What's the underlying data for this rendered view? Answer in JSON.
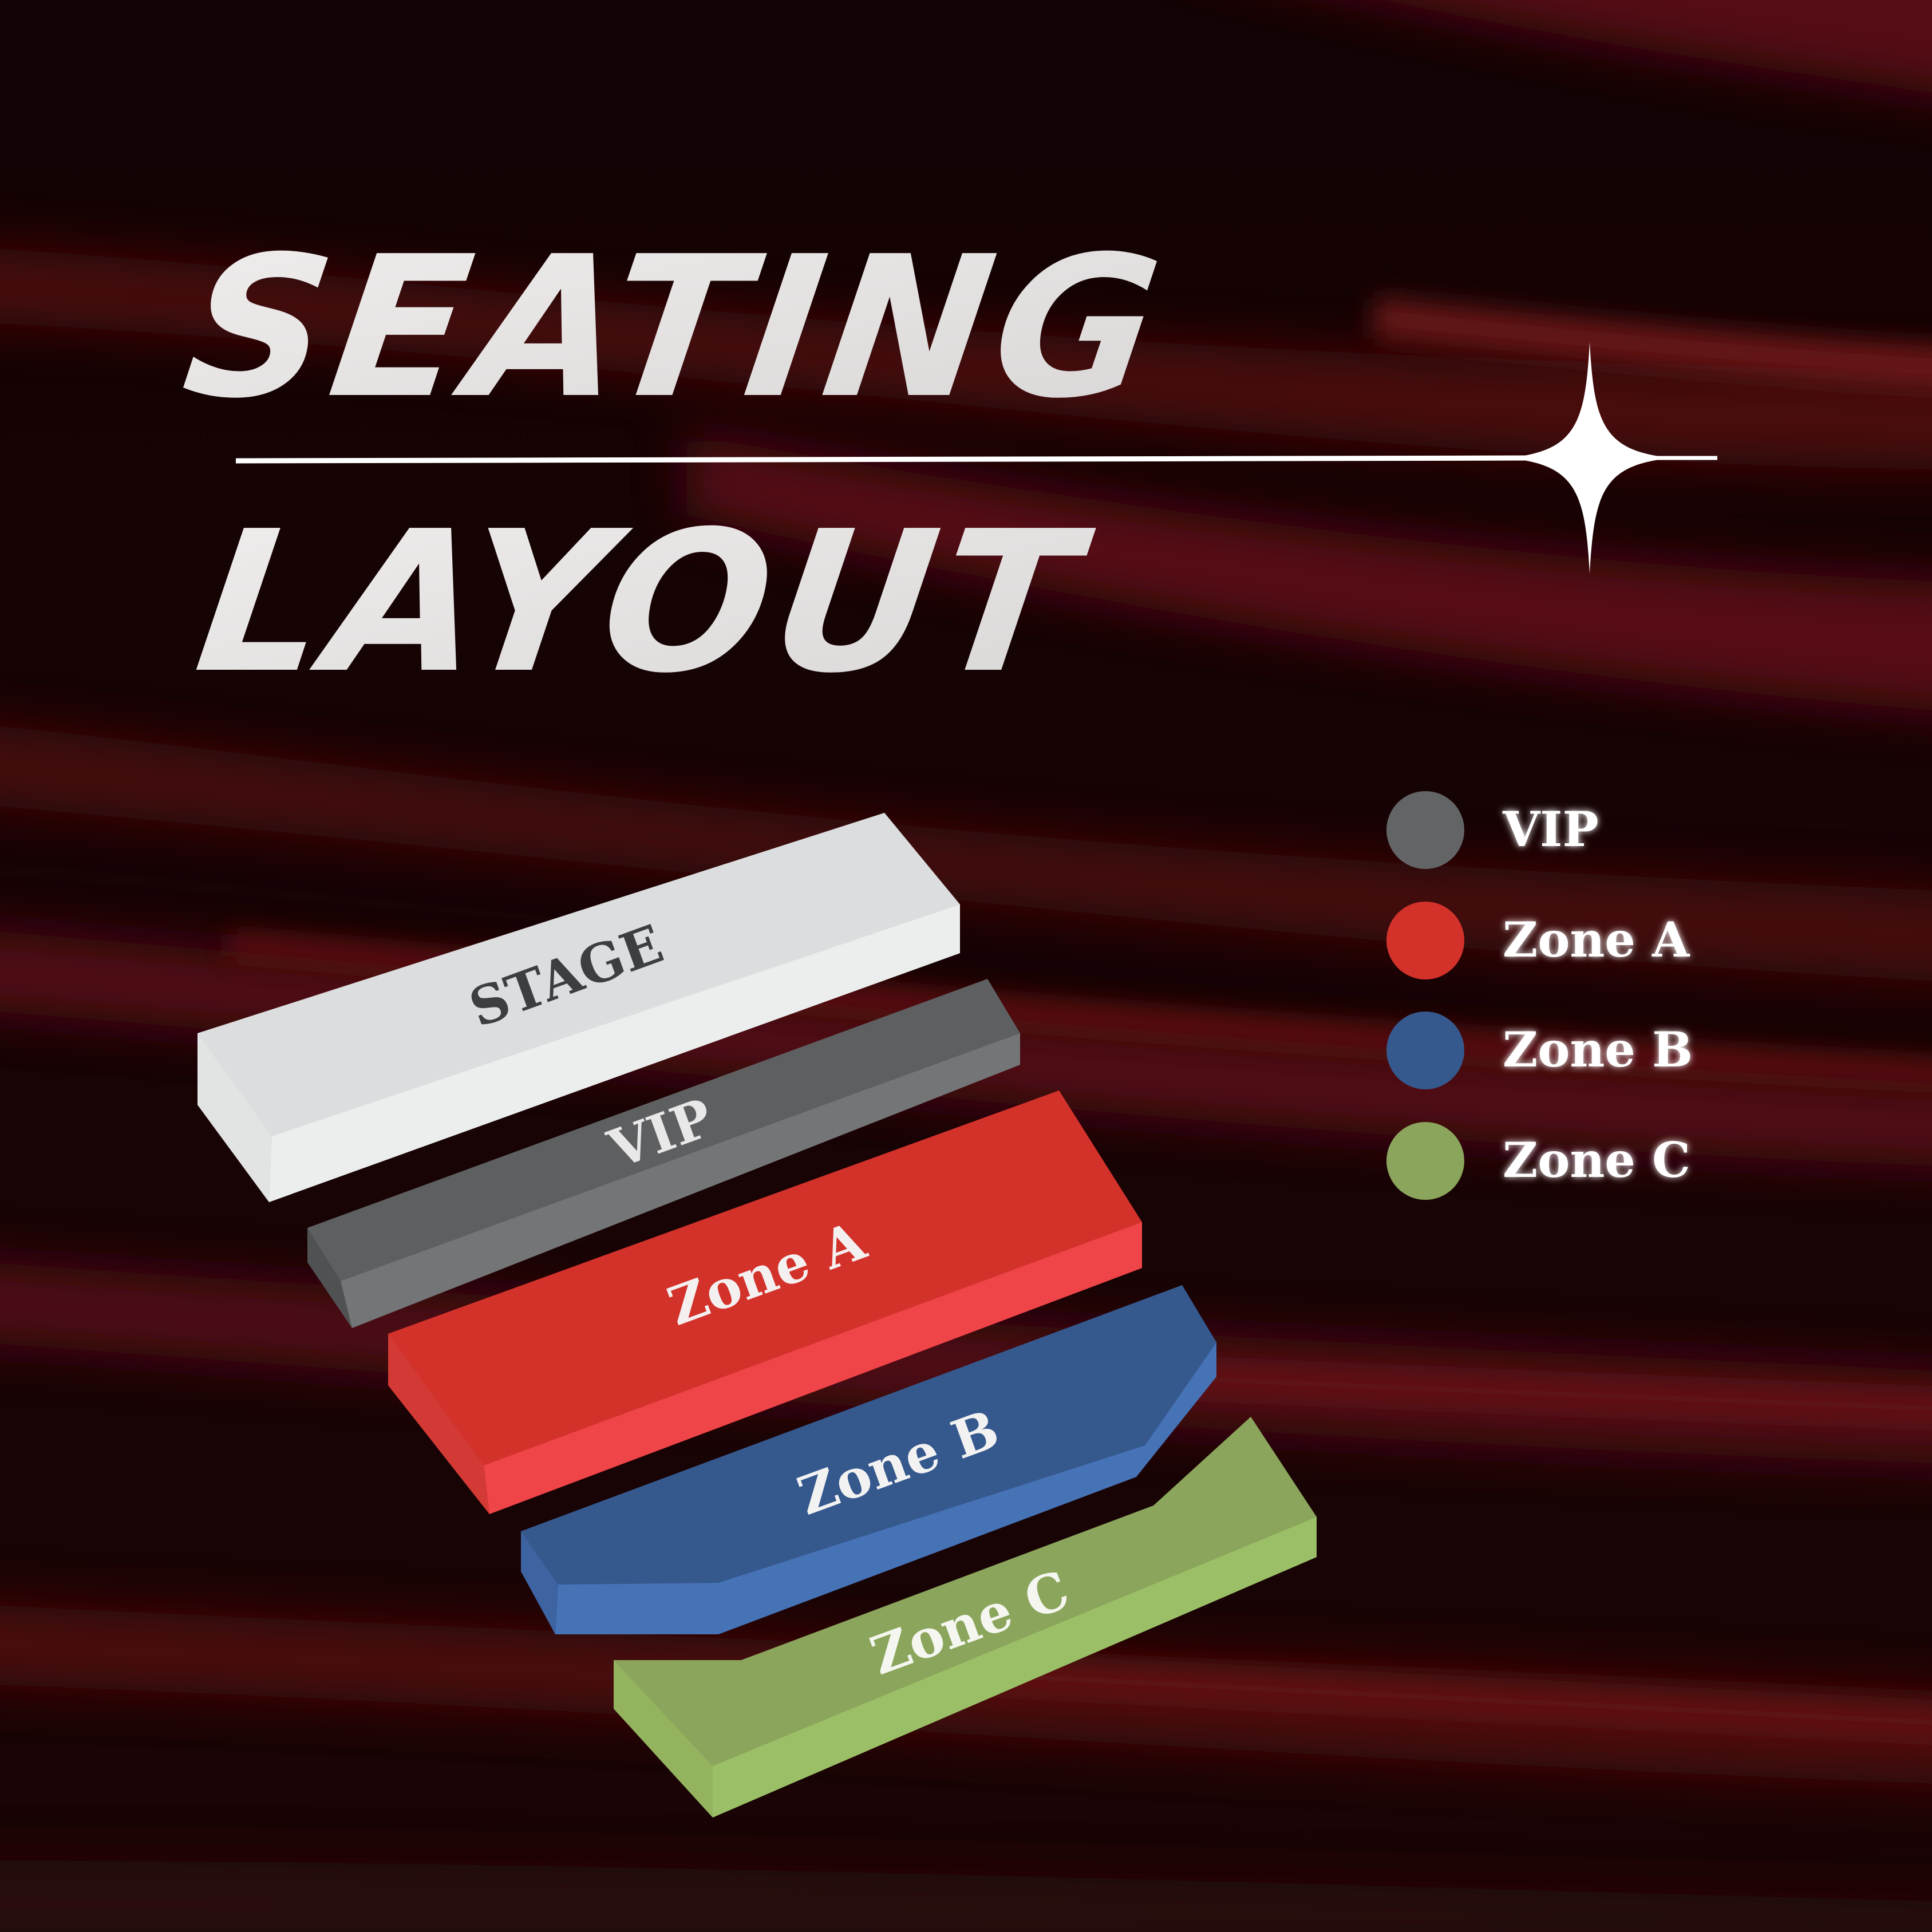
{
  "title": {
    "line1": "SEATING",
    "line2": "LAYOUT"
  },
  "colors": {
    "background_dark": "#0a0203",
    "background_red": "#5a0f12",
    "title_text": "#e6e4e4",
    "divider": "#ffffff",
    "stage": "#dfe0e1",
    "vip": "#636466",
    "zone_a": "#d3322b",
    "zone_b": "#35588d",
    "zone_c": "#8ba55c"
  },
  "blocks": {
    "stage": {
      "label": "STAGE",
      "color": "#dfe0e1"
    },
    "vip": {
      "label": "VIP",
      "color": "#636466"
    },
    "zone_a": {
      "label": "Zone A",
      "color": "#d3322b"
    },
    "zone_b": {
      "label": "Zone B",
      "color": "#35588d"
    },
    "zone_c": {
      "label": "Zone C",
      "color": "#8ba55c"
    }
  },
  "legend": {
    "items": [
      {
        "label": "VIP",
        "color": "#636466"
      },
      {
        "label": "Zone A",
        "color": "#d3322b"
      },
      {
        "label": "Zone B",
        "color": "#35588d"
      },
      {
        "label": "Zone C",
        "color": "#8ba55c"
      }
    ]
  },
  "icons": {
    "sparkle": "four-point-star-icon"
  }
}
